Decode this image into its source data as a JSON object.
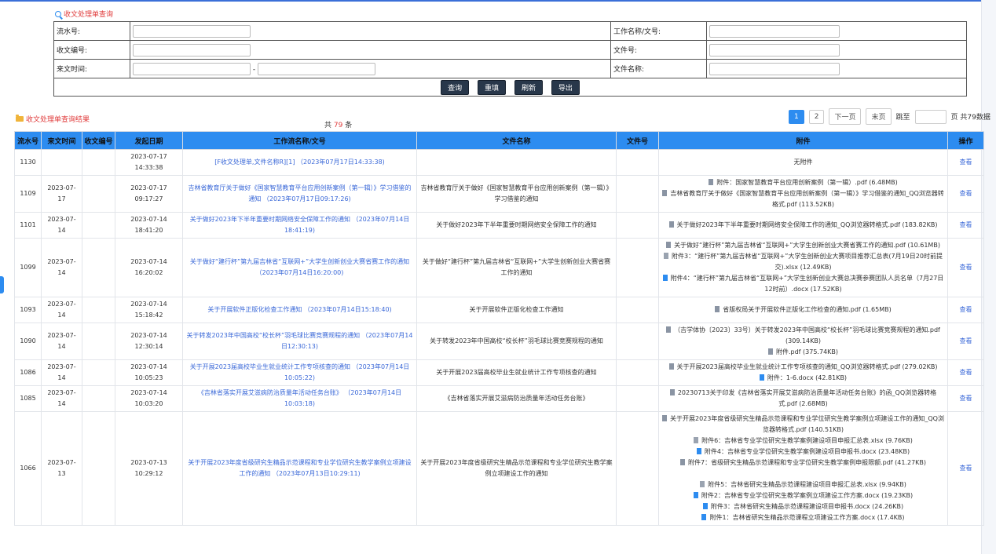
{
  "search_title": "收文处理单查询",
  "fields": {
    "serial_label": "流水号:",
    "workflow_label": "工作名称/文号:",
    "receipt_no_label": "收文编号:",
    "doc_no_label": "文件号:",
    "date_label": "来文时间:",
    "date_sep": "-",
    "filename_label": "文件名称:"
  },
  "buttons": {
    "query": "查询",
    "reset": "重填",
    "refresh": "刷新",
    "export": "导出"
  },
  "results_title": "收文处理单查询结果",
  "count": {
    "prefix": "共",
    "num": "79",
    "suffix": "条"
  },
  "pager": {
    "p1": "1",
    "p2": "2",
    "next": "下一页",
    "last": "末页",
    "jump": "跳至",
    "total": "页 共79数据"
  },
  "headers": [
    "流水号",
    "来文时间",
    "收文编号",
    "发起日期",
    "工作流名称/文号",
    "文件名称",
    "文件号",
    "附件",
    "操作"
  ],
  "rows": [
    {
      "id": "1130",
      "date": "",
      "no": "",
      "start": "2023-07-17 14:33:38",
      "flow": "[F收文处理单,文件名称R][1] （2023年07月17日14:33:38)",
      "fname": "",
      "docno": "",
      "atts": [
        {
          "type": "none",
          "text": "无附件"
        }
      ],
      "op": "查看"
    },
    {
      "id": "1109",
      "date": "2023-07-17",
      "no": "",
      "start": "2023-07-17 09:17:27",
      "flow": "吉林省教育厅关于做好《国家智慧教育平台应用创新案例（第一辑）》学习借鉴的通知 （2023年07月17日09:17:26)",
      "fname": "吉林省教育厅关于做好《国家智慧教育平台应用创新案例（第一辑）》学习借鉴的通知",
      "docno": "",
      "atts": [
        {
          "type": "pdf",
          "text": "附件：国家智慧教育平台应用创新案例（第一辑）.pdf (6.48MB)"
        },
        {
          "type": "pdf",
          "text": "吉林省教育厅关于做好《国家智慧教育平台应用创新案例（第一辑）》学习借鉴的通知_QQ浏览器转格式.pdf (113.52KB)"
        }
      ],
      "op": "查看"
    },
    {
      "id": "1101",
      "date": "2023-07-14",
      "no": "",
      "start": "2023-07-14 18:41:20",
      "flow": "关于做好2023年下半年重要时期网络安全保障工作的通知 （2023年07月14日18:41:19)",
      "fname": "关于做好2023年下半年重要时期网络安全保障工作的通知",
      "docno": "",
      "atts": [
        {
          "type": "pdf",
          "text": "关于做好2023年下半年重要时期网络安全保障工作的通知_QQ浏览器转格式.pdf (183.82KB)"
        }
      ],
      "op": "查看"
    },
    {
      "id": "1099",
      "date": "2023-07-14",
      "no": "",
      "start": "2023-07-14 16:20:02",
      "flow": "关于做好“建行杯”第九届吉林省“互联网+”大学生创新创业大赛省赛工作的通知 （2023年07月14日16:20:00)",
      "fname": "关于做好“建行杯”第九届吉林省“互联网+”大学生创新创业大赛省赛工作的通知",
      "docno": "",
      "atts": [
        {
          "type": "pdf",
          "text": "关于做好“建行杯”第九届吉林省“互联网+”大学生创新创业大赛省赛工作的通知.pdf (10.61MB)"
        },
        {
          "type": "xlsx",
          "text": "附件3：“建行杯”第九届吉林省“互联网+”大学生创新创业大赛项目推荐汇总表(7月19日20时前提交).xlsx (12.49KB)"
        },
        {
          "type": "docx",
          "text": "附件4：“建行杯”第九届吉林省“互联网+”大学生创新创业大赛总决赛参赛团队人员名单（7月27日12时前）.docx (17.52KB)"
        }
      ],
      "op": "查看"
    },
    {
      "id": "1093",
      "date": "2023-07-14",
      "no": "",
      "start": "2023-07-14 15:18:42",
      "flow": "关于开展软件正版化检查工作通知 （2023年07月14日15:18:40)",
      "fname": "关于开展软件正版化检查工作通知",
      "docno": "",
      "atts": [
        {
          "type": "pdf",
          "text": "省版权局关于开展软件正版化工作检查的通知.pdf (1.65MB)"
        }
      ],
      "op": "查看"
    },
    {
      "id": "1090",
      "date": "2023-07-14",
      "no": "",
      "start": "2023-07-14 12:30:14",
      "flow": "关于转发2023年中国高校“校长杯”羽毛球比赛竞赛规程的通知 （2023年07月14日12:30:13)",
      "fname": "关于转发2023年中国高校“校长杯”羽毛球比赛竞赛规程的通知",
      "docno": "",
      "atts": [
        {
          "type": "pdf",
          "text": "（吉学体协〔2023〕33号）关于转发2023年中国高校“校长杯”羽毛球比赛竞赛规程的通知.pdf (309.14KB)"
        },
        {
          "type": "pdf",
          "text": "附件.pdf (375.74KB)"
        }
      ],
      "op": "查看"
    },
    {
      "id": "1086",
      "date": "2023-07-14",
      "no": "",
      "start": "2023-07-14 10:05:23",
      "flow": "关于开展2023届高校毕业生就业统计工作专项核查的通知 （2023年07月14日10:05:22)",
      "fname": "关于开展2023届高校毕业生就业统计工作专项核查的通知",
      "docno": "",
      "atts": [
        {
          "type": "pdf",
          "text": "关于开展2023届高校毕业生就业统计工作专项核查的通知_QQ浏览器转格式.pdf (279.02KB)"
        },
        {
          "type": "docx",
          "text": "附件：1-6.docx (42.81KB)"
        }
      ],
      "op": "查看"
    },
    {
      "id": "1085",
      "date": "2023-07-14",
      "no": "",
      "start": "2023-07-14 10:03:20",
      "flow": "《吉林省落实开展艾滋病防治质量年活动任务台账》 （2023年07月14日10:03:18)",
      "fname": "《吉林省落实开展艾滋病防治质量年活动任务台账》",
      "docno": "",
      "atts": [
        {
          "type": "pdf",
          "text": "20230713关于印发《吉林省落实开展艾滋病防治质量年活动任务台账》的函_QQ浏览器转格式.pdf (2.68MB)"
        }
      ],
      "op": "查看"
    },
    {
      "id": "1066",
      "date": "2023-07-13",
      "no": "",
      "start": "2023-07-13 10:29:12",
      "flow": "关于开展2023年度省级研究生精品示范课程和专业学位研究生教学案例立项建设工作的通知 （2023年07月13日10:29:11)",
      "fname": "关于开展2023年度省级研究生精品示范课程和专业学位研究生教学案例立项建设工作的通知",
      "docno": "",
      "atts": [
        {
          "type": "pdf",
          "text": "关于开展2023年度省级研究生精品示范课程和专业学位研究生教学案例立项建设工作的通知_QQ浏览器转格式.pdf (140.51KB)"
        },
        {
          "type": "xlsx",
          "text": "附件6：吉林省专业学位研究生教学案例建设项目申报汇总表.xlsx (9.76KB)"
        },
        {
          "type": "docx",
          "text": "附件4：吉林省专业学位研究生教学案例建设项目申报书.docx (23.48KB)"
        },
        {
          "type": "pdf",
          "text": "附件7：省级研究生精品示范课程和专业学位研究生教学案例申报限额.pdf (41.27KB)"
        },
        {
          "type": "gap",
          "text": ""
        },
        {
          "type": "xlsx",
          "text": "附件5：吉林省研究生精品示范课程建设项目申报汇总表.xlsx (9.94KB)"
        },
        {
          "type": "docx",
          "text": "附件2：吉林省专业学位研究生教学案例立项建设工作方案.docx (19.23KB)"
        },
        {
          "type": "docx",
          "text": "附件3：吉林省研究生精品示范课程建设项目申报书.docx (24.26KB)"
        },
        {
          "type": "docx",
          "text": "附件1：吉林省研究生精品示范课程立项建设工作方案.docx (17.4KB)"
        }
      ],
      "op": "查看"
    }
  ]
}
